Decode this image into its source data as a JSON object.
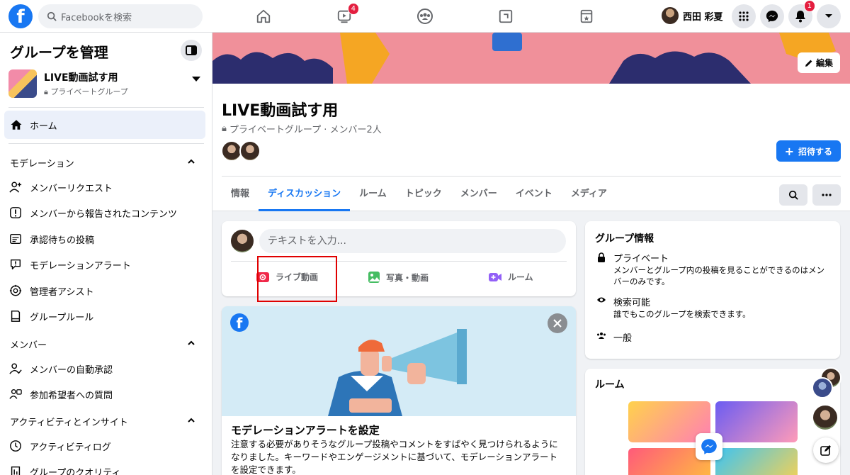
{
  "topbar": {
    "search_placeholder": "Facebookを検索",
    "watch_badge": "4",
    "notifications_badge": "1",
    "user_name": "西田 彩夏"
  },
  "sidebar": {
    "title": "グループを管理",
    "group_name": "LIVE動画試す用",
    "group_privacy": "プライベートグループ",
    "home_label": "ホーム",
    "sections": {
      "moderation": "モデレーション",
      "members": "メンバー",
      "activity": "アクティビティとインサイト"
    },
    "moderation_items": [
      {
        "label": "メンバーリクエスト",
        "icon": "member-add-icon"
      },
      {
        "label": "メンバーから報告されたコンテンツ",
        "icon": "report-icon"
      },
      {
        "label": "承認待ちの投稿",
        "icon": "pending-posts-icon"
      },
      {
        "label": "モデレーションアラート",
        "icon": "alert-icon"
      },
      {
        "label": "管理者アシスト",
        "icon": "admin-assist-icon"
      },
      {
        "label": "グループルール",
        "icon": "rules-icon"
      }
    ],
    "member_items": [
      {
        "label": "メンバーの自動承認",
        "icon": "auto-approve-icon"
      },
      {
        "label": "参加希望者への質問",
        "icon": "questions-icon"
      }
    ],
    "activity_items": [
      {
        "label": "アクティビティログ",
        "icon": "activity-log-icon"
      },
      {
        "label": "グループのクオリティ",
        "icon": "quality-icon"
      }
    ]
  },
  "header": {
    "edit_label": "編集",
    "group_title": "LIVE動画試す用",
    "meta": "プライベートグループ · メンバー2人",
    "invite_label": "招待する",
    "tabs": [
      "情報",
      "ディスカッション",
      "ルーム",
      "トピック",
      "メンバー",
      "イベント",
      "メディア"
    ],
    "active_tab": "ディスカッション"
  },
  "composer": {
    "placeholder": "テキストを入力...",
    "actions": {
      "live": "ライブ動画",
      "photo": "写真・動画",
      "room": "ルーム"
    }
  },
  "moderation_card": {
    "title": "モデレーションアラートを設定",
    "body": "注意する必要がありそうなグループ投稿やコメントをすばやく見つけられるようになりました。キーワードやエンゲージメントに基づいて、モデレーションアラートを設定できます。"
  },
  "group_info": {
    "title": "グループ情報",
    "rows": [
      {
        "heading": "プライベート",
        "desc": "メンバーとグループ内の投稿を見ることができるのはメンバーのみです。"
      },
      {
        "heading": "検索可能",
        "desc": "誰でもこのグループを検索できます。"
      },
      {
        "heading": "一般",
        "desc": ""
      }
    ]
  },
  "rooms": {
    "title": "ルーム"
  },
  "colors": {
    "brand": "#1877f2",
    "highlight_box": "#e00000",
    "badge": "#e41e3f"
  }
}
